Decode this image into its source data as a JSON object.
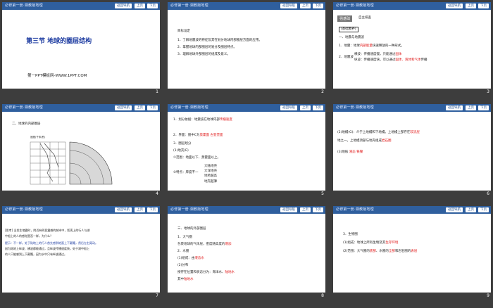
{
  "header": {
    "brand": "必修第一册·湘教版地理",
    "nav": "返回导航",
    "prev": "上页",
    "next": "下页"
  },
  "slides": [
    {
      "page": "1",
      "title": "第三节  地球的圈层结构",
      "sub": "第一PPT模板网-WWW.1PPT.COM"
    },
    {
      "page": "2",
      "heading": "目标设定",
      "lines": [
        "1．了解地震波的特征及其在划分地球内部圈层方面的应用。",
        "2．掌握地球内部圈层的划分及圈层特点。",
        "3．理解地球外部圈层的组成及意义。"
      ]
    },
    {
      "page": "3",
      "tag": "强基础",
      "tag2": "自主排查",
      "box": "[基础素养]",
      "l1": "一、地震与地震波",
      "l2": "1．地震：地球",
      "l2r": "内部能量",
      "l2b": "快速释放的一种形式。",
      "l3": "2．地震波",
      "l3a": "横波：传播速度慢，只能通过",
      "l3ar": "固体",
      "l3b": "纵波：传播速度快，可以通过",
      "l3br": "固体、液体和气体",
      "l3bc": "传播"
    },
    {
      "page": "4",
      "heading": "二、地球的内部圈层",
      "axis": "速度(千米/秒)",
      "depth": "深度(千米)"
    },
    {
      "page": "5",
      "lines": [
        "1．划分依据：地震波在地球内部",
        "2．界面：图中C为",
        "3．圈层划分",
        "(1)地壳(E)",
        "①范围：地面以下、莫霍面以上。",
        "②特点：厚度不一"
      ],
      "r1": "传播速度",
      "r2": "莫霍面",
      "r3": "古登堡面",
      "sub": [
        "大陆地壳",
        "大洋地壳",
        "地势越高",
        "地壳越薄"
      ]
    },
    {
      "page": "6",
      "l1": "(2)地幔(G)：介于上地幔和下地幔。上地幔上部存在",
      "r1": "软流层",
      "l2": "地之一。上地幔顶部与地壳组成",
      "r2": "岩石圈",
      "l3": "(3)地核",
      "r3": "液态",
      "r4": "铁镍"
    },
    {
      "page": "7",
      "l1": "[思考] 当发生地震时，附近有明显震感的城市中，距离上的行人与湖",
      "l2": "中船上的人的感觉是否一样，为什么？",
      "l3": "提示：不一样。处于陆地上的行人首先感到地面上下颠簸，然后左右晃动。",
      "l4": "因为陆地上纵波、横波都能通过，且纵波传播速度快。处于湖中船上",
      "l5": "的人只能感到上下颠簸，因为水中只有纵波通过。"
    },
    {
      "page": "8",
      "heading": "三、地球的外部圈层",
      "l1": "1．大气圈",
      "l2": "包裹地球的气体层，密度随高度的",
      "r2": "增加",
      "l3": "2．水圈",
      "l4": "(1)组成：由",
      "r4": "液态水",
      "l5": "(2)分布",
      "l6": "按存在位置和状态分为：海洋水、",
      "r6": "陆地水",
      "l7": "其中",
      "r7": "陆地水"
    },
    {
      "page": "9",
      "l1": "3．生物圈",
      "l2": "(1)组成：地球上所有生物及其",
      "r2": "生存环境",
      "l3": "(2)范围：大气圈的",
      "r3": "底部",
      "l3b": "、水圈的",
      "r3b": "全部",
      "l3c": "和岩石圈的",
      "r3c": "表层"
    }
  ]
}
